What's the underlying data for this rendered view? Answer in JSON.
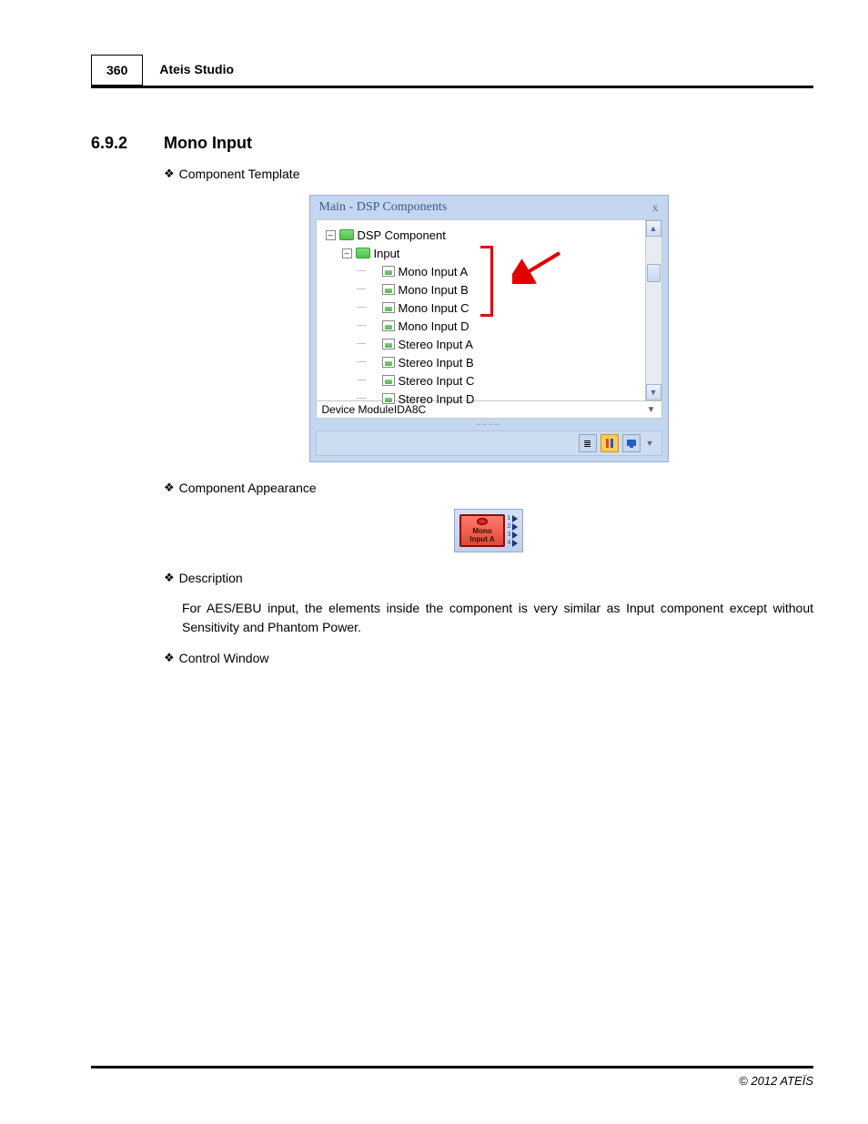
{
  "header": {
    "page_number": "360",
    "title": "Ateis Studio"
  },
  "section": {
    "number": "6.9.2",
    "title": "Mono Input"
  },
  "bullets": {
    "component_template": "Component Template",
    "component_appearance": "Component Appearance",
    "description": "Description",
    "control_window": "Control Window"
  },
  "panel": {
    "title": "Main - DSP Components",
    "close": "x",
    "tree": {
      "root": "DSP Component",
      "input": "Input",
      "items": [
        "Mono Input A",
        "Mono Input B",
        "Mono Input C",
        "Mono Input D",
        "Stereo Input A",
        "Stereo Input B",
        "Stereo Input C",
        "Stereo Input D"
      ]
    },
    "dropdown_label": "Device Module",
    "dropdown_value": "IDA8C"
  },
  "component": {
    "line1": "Mono",
    "line2": "Input A",
    "pins": [
      "1",
      "2",
      "3",
      "4"
    ]
  },
  "description_text": "For AES/EBU input, the elements inside the component is very similar as Input component except without Sensitivity and Phantom Power.",
  "footer": "© 2012 ATEÏS"
}
